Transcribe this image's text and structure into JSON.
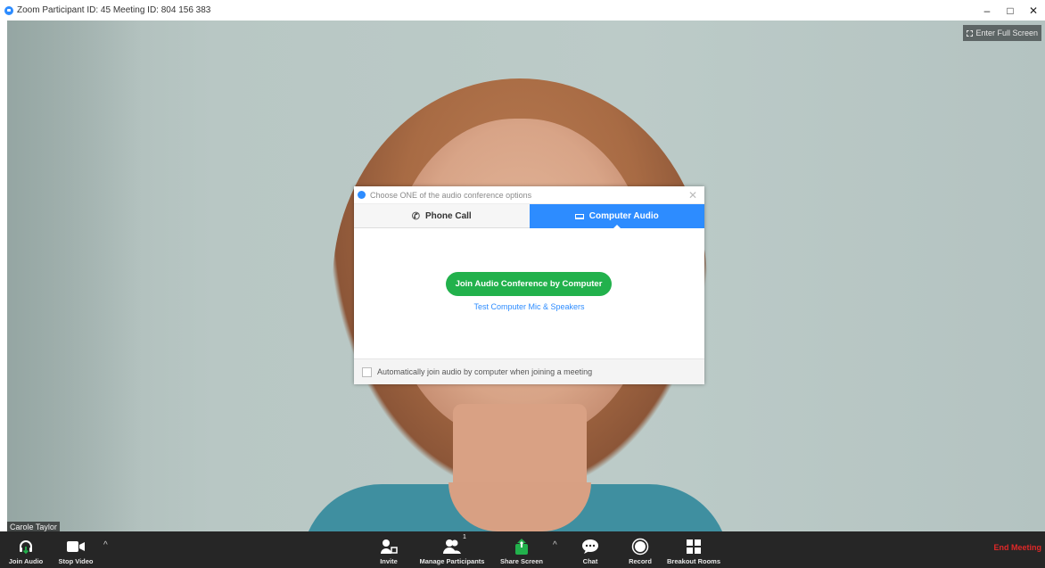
{
  "titlebar": {
    "title": "Zoom Participant ID: 45   Meeting ID: 804 156 383",
    "minimize": "–",
    "maximize": "□",
    "close": "✕"
  },
  "video": {
    "fullscreen_label": "Enter Full Screen",
    "participant_name": "Carole Taylor"
  },
  "dialog": {
    "title": "Choose ONE of the audio conference options",
    "close": "✕",
    "tabs": [
      {
        "label": "Phone Call",
        "icon": "phone-icon"
      },
      {
        "label": "Computer Audio",
        "icon": "laptop-icon",
        "selected": true
      }
    ],
    "join_button": "Join Audio Conference by Computer",
    "test_link": "Test Computer Mic & Speakers",
    "auto_join_label": "Automatically join audio by computer when joining a meeting"
  },
  "toolbar": {
    "items": [
      {
        "label": "Join Audio",
        "icon": "headphones-icon"
      },
      {
        "label": "Stop Video",
        "icon": "video-camera-icon"
      },
      {
        "label": "Invite",
        "icon": "invite-icon"
      },
      {
        "label": "Manage Participants",
        "icon": "participants-icon",
        "count": "1"
      },
      {
        "label": "Share Screen",
        "icon": "share-screen-icon"
      },
      {
        "label": "Chat",
        "icon": "chat-icon"
      },
      {
        "label": "Record",
        "icon": "record-icon"
      },
      {
        "label": "Breakout Rooms",
        "icon": "breakout-rooms-icon"
      }
    ],
    "caret": "^",
    "end_meeting": "End Meeting"
  },
  "colors": {
    "accent_blue": "#2d8cff",
    "join_green": "#22b14c",
    "toolbar_bg": "#262626",
    "end_red": "#e02828"
  }
}
